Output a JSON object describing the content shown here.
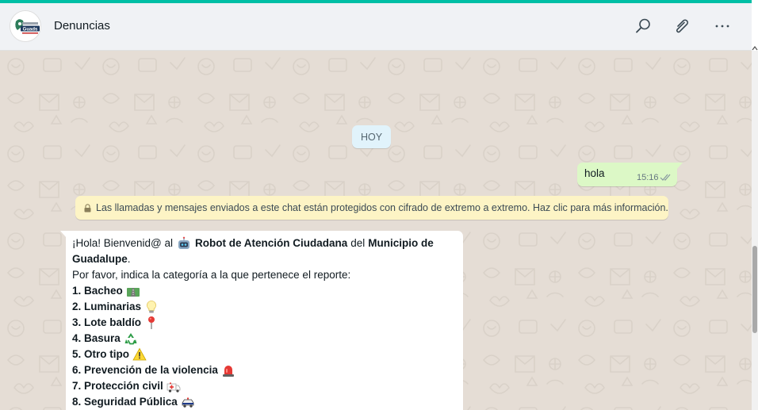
{
  "header": {
    "chat_name": "Denuncias",
    "avatar_logo_text": "Guads",
    "icons": [
      "search-icon",
      "attach-icon",
      "menu-icon"
    ]
  },
  "chat": {
    "date_separator": "HOY",
    "outgoing": {
      "text": "hola",
      "time": "15:16",
      "status": "read"
    },
    "encryption_notice": "Las llamadas y mensajes enviados a este chat están protegidos con cifrado de extremo a extremo. Haz clic para más información.",
    "incoming": {
      "greeting_prefix": "¡Hola! Bienvenid@ al",
      "robot_name": "Robot de Atención Ciudadana",
      "connector": "del",
      "municipality": "Municipio de",
      "municipality_name": "Guadalupe",
      "period": ".",
      "instruction": "Por favor, indica la categoría a la que pertenece el reporte:",
      "options": [
        {
          "label": "1. Bacheo",
          "emoji": "road-emoji"
        },
        {
          "label": "2. Luminarias",
          "emoji": "lightbulb-emoji"
        },
        {
          "label": "3. Lote baldío",
          "emoji": "pushpin-emoji"
        },
        {
          "label": "4. Basura",
          "emoji": "recycle-emoji"
        },
        {
          "label": "5. Otro tipo",
          "emoji": "warning-emoji"
        },
        {
          "label": "6. Prevención de la violencia",
          "emoji": "siren-emoji"
        },
        {
          "label": "7. Protección civil",
          "emoji": "ambulance-emoji"
        },
        {
          "label": "8. Seguridad Pública",
          "emoji": "police-car-emoji"
        }
      ]
    }
  },
  "colors": {
    "accent": "#00bfa5",
    "header_bg": "#f0f2f5",
    "chat_bg": "#e5ddd5",
    "outgoing_bubble": "#dcf8c6",
    "incoming_bubble": "#ffffff",
    "notice_bg": "#fdf4c5",
    "date_chip": "#e1f3fb",
    "read_ticks": "#53bdeb"
  }
}
